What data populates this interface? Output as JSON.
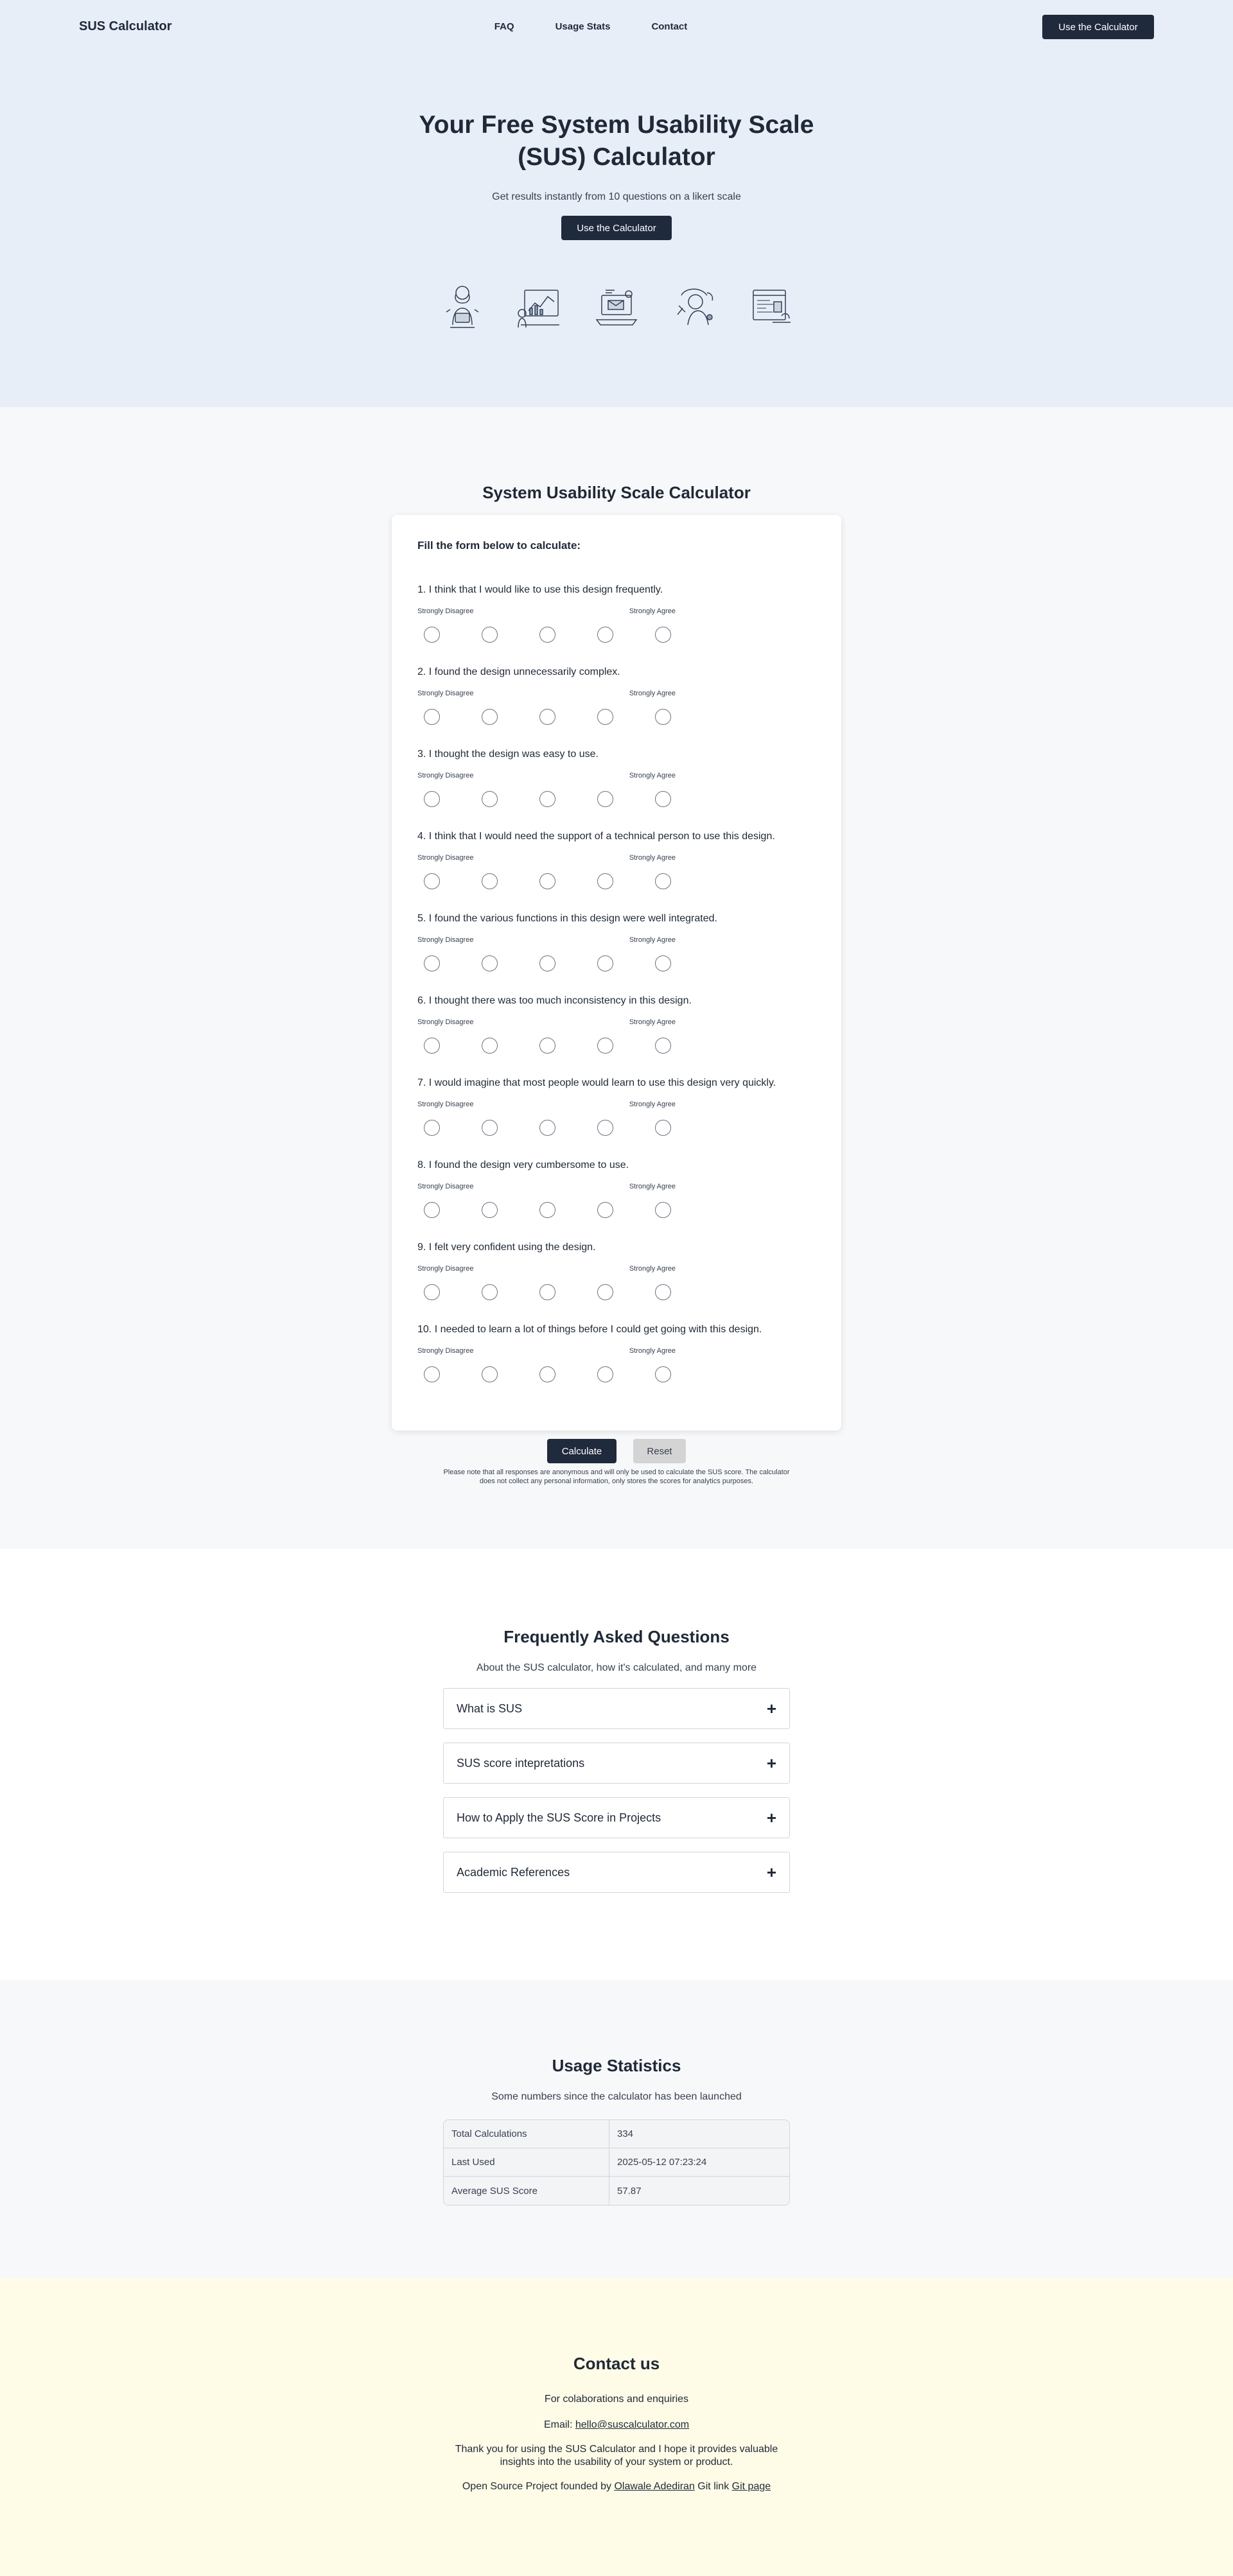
{
  "header": {
    "brand": "SUS Calculator",
    "nav": [
      "FAQ",
      "Usage Stats",
      "Contact"
    ],
    "cta": "Use the Calculator"
  },
  "hero": {
    "title_line1": "Your Free System Usability Scale",
    "title_line2": "(SUS) Calculator",
    "subtitle": "Get results instantly from 10 questions on a likert scale",
    "cta": "Use the Calculator",
    "illustrations": [
      "woman-laptop-illustration",
      "analytics-chart-illustration",
      "laptop-email-illustration",
      "support-headset-illustration",
      "browser-window-illustration"
    ]
  },
  "calculator": {
    "title": "System Usability Scale Calculator",
    "form_heading": "Fill the form below to calculate:",
    "scale_min": "Strongly Disagree",
    "scale_max": "Strongly Agree",
    "questions": [
      "1. I think that I would like to use this design frequently.",
      "2. I found the design unnecessarily complex.",
      "3. I thought the design was easy to use.",
      "4. I think that I would need the support of a technical person to use this design.",
      "5. I found the various functions in this design were well integrated.",
      "6. I thought there was too much inconsistency in this design.",
      "7. I would imagine that most people would learn to use this design very quickly.",
      "8. I found the design very cumbersome to use.",
      "9. I felt very confident using the design.",
      "10. I needed to learn a lot of things before I could get going with this design."
    ],
    "calculate_label": "Calculate",
    "reset_label": "Reset",
    "note": "Please note that all responses are anonymous and will only be used to calculate the SUS score. The calculator does not collect any personal information, only stores the scores for analytics purposes."
  },
  "faq": {
    "title": "Frequently Asked Questions",
    "subtitle": "About the SUS calculator, how it's calculated, and many more",
    "items": [
      "What is SUS",
      "SUS score intepretations",
      "How to Apply the SUS Score in Projects",
      "Academic References"
    ]
  },
  "stats": {
    "title": "Usage Statistics",
    "subtitle": "Some numbers since the calculator has been launched",
    "rows": [
      {
        "label": "Total Calculations",
        "value": "334"
      },
      {
        "label": "Last Used",
        "value": "2025-05-12 07:23:24"
      },
      {
        "label": "Average SUS Score",
        "value": "57.87"
      }
    ]
  },
  "contact": {
    "title": "Contact us",
    "line1": "For colaborations and enquiries",
    "email_prefix": "Email: ",
    "email": "hello@suscalculator.com",
    "thanks": "Thank you for using the SUS Calculator and I hope it provides valuable insights into the usability of your system or product.",
    "founded_prefix": "Open Source Project founded by ",
    "founder": "Olawale Adediran",
    "git_prefix": " Git link ",
    "git_label": "Git page"
  },
  "colors": {
    "hero_bg": "#e8eef7",
    "section_bg": "#f7f8fa",
    "contact_bg": "#fefbe6",
    "primary": "#1f2a3c"
  }
}
